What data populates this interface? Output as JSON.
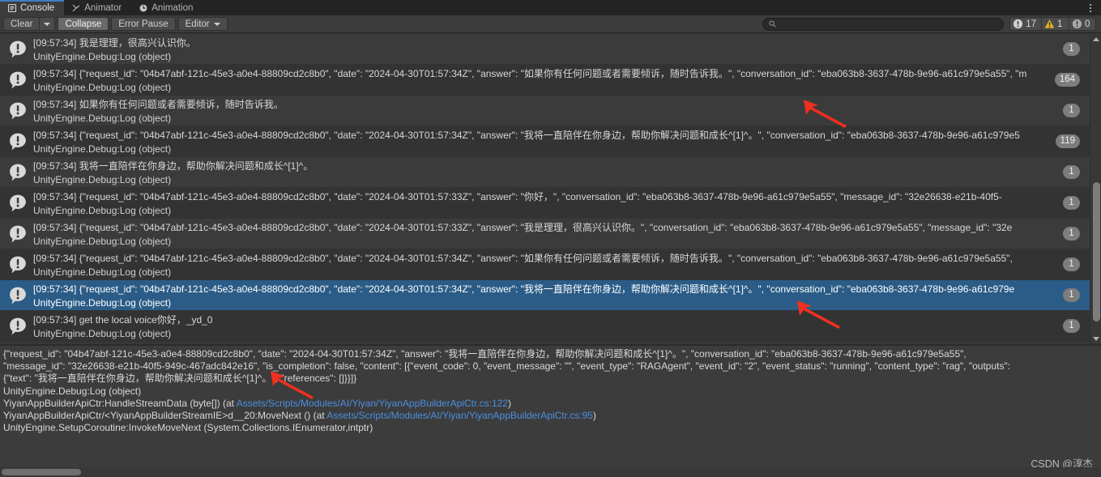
{
  "window": {
    "tabs": [
      {
        "label": "Console",
        "icon": "console-icon",
        "active": true
      },
      {
        "label": "Animator",
        "icon": "animator-icon",
        "active": false
      },
      {
        "label": "Animation",
        "icon": "animation-icon",
        "active": false
      }
    ],
    "options_icon": "kebab-menu-icon"
  },
  "toolbar": {
    "clear_label": "Clear",
    "clear_dropdown_icon": "chevron-down-icon",
    "collapse_label": "Collapse",
    "collapse_active": true,
    "error_pause_label": "Error Pause",
    "editor_label": "Editor",
    "editor_dropdown_icon": "chevron-down-icon",
    "search": {
      "value": "",
      "placeholder": "",
      "icon": "search-icon"
    },
    "counters": [
      {
        "icon": "log-count-icon",
        "value": "17",
        "name": "log-count"
      },
      {
        "icon": "warning-count-icon",
        "value": "1",
        "name": "warning-count"
      },
      {
        "icon": "error-count-icon",
        "value": "0",
        "name": "error-count"
      }
    ]
  },
  "log_entries": [
    {
      "message": "[09:57:34] 我是理理，很高兴认识你。",
      "stack": "UnityEngine.Debug:Log (object)",
      "count": "1",
      "icon": "log-message-icon",
      "selected": false
    },
    {
      "message": "[09:57:34] {\"request_id\": \"04b47abf-121c-45e3-a0e4-88809cd2c8b0\", \"date\": \"2024-04-30T01:57:34Z\", \"answer\": \"如果你有任何问题或者需要倾诉，随时告诉我。\", \"conversation_id\": \"eba063b8-3637-478b-9e96-a61c979e5a55\", \"m",
      "stack": "UnityEngine.Debug:Log (object)",
      "count": "164",
      "icon": "log-message-icon",
      "selected": false
    },
    {
      "message": "[09:57:34] 如果你有任何问题或者需要倾诉，随时告诉我。",
      "stack": "UnityEngine.Debug:Log (object)",
      "count": "1",
      "icon": "log-message-icon",
      "selected": false
    },
    {
      "message": "[09:57:34] {\"request_id\": \"04b47abf-121c-45e3-a0e4-88809cd2c8b0\", \"date\": \"2024-04-30T01:57:34Z\", \"answer\": \"我将一直陪伴在你身边，帮助你解决问题和成长^[1]^。\", \"conversation_id\": \"eba063b8-3637-478b-9e96-a61c979e5",
      "stack": "UnityEngine.Debug:Log (object)",
      "count": "119",
      "icon": "log-message-icon",
      "selected": false
    },
    {
      "message": "[09:57:34] 我将一直陪伴在你身边，帮助你解决问题和成长^[1]^。",
      "stack": "UnityEngine.Debug:Log (object)",
      "count": "1",
      "icon": "log-message-icon",
      "selected": false
    },
    {
      "message": "[09:57:34] {\"request_id\": \"04b47abf-121c-45e3-a0e4-88809cd2c8b0\", \"date\": \"2024-04-30T01:57:33Z\", \"answer\": \"你好，\", \"conversation_id\": \"eba063b8-3637-478b-9e96-a61c979e5a55\", \"message_id\": \"32e26638-e21b-40f5-",
      "stack": "UnityEngine.Debug:Log (object)",
      "count": "1",
      "icon": "log-message-icon",
      "selected": false
    },
    {
      "message": "[09:57:34] {\"request_id\": \"04b47abf-121c-45e3-a0e4-88809cd2c8b0\", \"date\": \"2024-04-30T01:57:33Z\", \"answer\": \"我是理理，很高兴认识你。\", \"conversation_id\": \"eba063b8-3637-478b-9e96-a61c979e5a55\", \"message_id\": \"32e",
      "stack": "UnityEngine.Debug:Log (object)",
      "count": "1",
      "icon": "log-message-icon",
      "selected": false
    },
    {
      "message": "[09:57:34] {\"request_id\": \"04b47abf-121c-45e3-a0e4-88809cd2c8b0\", \"date\": \"2024-04-30T01:57:34Z\", \"answer\": \"如果你有任何问题或者需要倾诉，随时告诉我。\", \"conversation_id\": \"eba063b8-3637-478b-9e96-a61c979e5a55\",",
      "stack": "UnityEngine.Debug:Log (object)",
      "count": "1",
      "icon": "log-message-icon",
      "selected": false
    },
    {
      "message": "[09:57:34] {\"request_id\": \"04b47abf-121c-45e3-a0e4-88809cd2c8b0\", \"date\": \"2024-04-30T01:57:34Z\", \"answer\": \"我将一直陪伴在你身边，帮助你解决问题和成长^[1]^。\", \"conversation_id\": \"eba063b8-3637-478b-9e96-a61c979e",
      "stack": "UnityEngine.Debug:Log (object)",
      "count": "1",
      "icon": "log-message-icon",
      "selected": true
    },
    {
      "message": "[09:57:34] get the local voice你好，_yd_0",
      "stack": "UnityEngine.Debug:Log (object)",
      "count": "1",
      "icon": "log-message-icon",
      "selected": false
    }
  ],
  "detail_pane": {
    "lines": [
      "{\"request_id\": \"04b47abf-121c-45e3-a0e4-88809cd2c8b0\", \"date\": \"2024-04-30T01:57:34Z\", \"answer\": \"我将一直陪伴在你身边，帮助你解决问题和成长^[1]^。\", \"conversation_id\": \"eba063b8-3637-478b-9e96-a61c979e5a55\",",
      "\"message_id\": \"32e26638-e21b-40f5-949c-467adc842e16\", \"is_completion\": false, \"content\": [{\"event_code\": 0, \"event_message\": \"\", \"event_type\": \"RAGAgent\", \"event_id\": \"2\", \"event_status\": \"running\", \"content_type\": \"rag\", \"outputs\":",
      "{\"text\": \"我将一直陪伴在你身边，帮助你解决问题和成长^[1]^。\", \"references\": []}}]}",
      "UnityEngine.Debug:Log (object)"
    ],
    "stack_lines": [
      {
        "prefix": "YiyanAppBuilderApiCtr:HandleStreamData (byte[]) (at ",
        "link": "Assets/Scripts/Modules/AI/Yiyan/YiyanAppBuilderApiCtr.cs:122",
        "suffix": ")"
      },
      {
        "prefix": "YiyanAppBuilderApiCtr/<YiyanAppBuilderStreamIE>d__20:MoveNext () (at ",
        "link": "Assets/Scripts/Modules/AI/Yiyan/YiyanAppBuilderApiCtr.cs:95",
        "suffix": ")"
      },
      {
        "prefix": "UnityEngine.SetupCoroutine:InvokeMoveNext (System.Collections.IEnumerator,intptr)",
        "link": "",
        "suffix": ""
      }
    ]
  },
  "watermark": {
    "text": "CSDN @淳杰"
  },
  "colors": {
    "background": "#383838",
    "tabstrip": "#242424",
    "toolbar": "#3c3c3c",
    "selection_blue": "#2b5c87",
    "tab_accent": "#3d7ec4",
    "link_blue": "#4a8fe0",
    "badge_grey": "#7d7d7d",
    "warning_yellow": "#e3b02a",
    "annotation_red": "#ef2f20"
  }
}
